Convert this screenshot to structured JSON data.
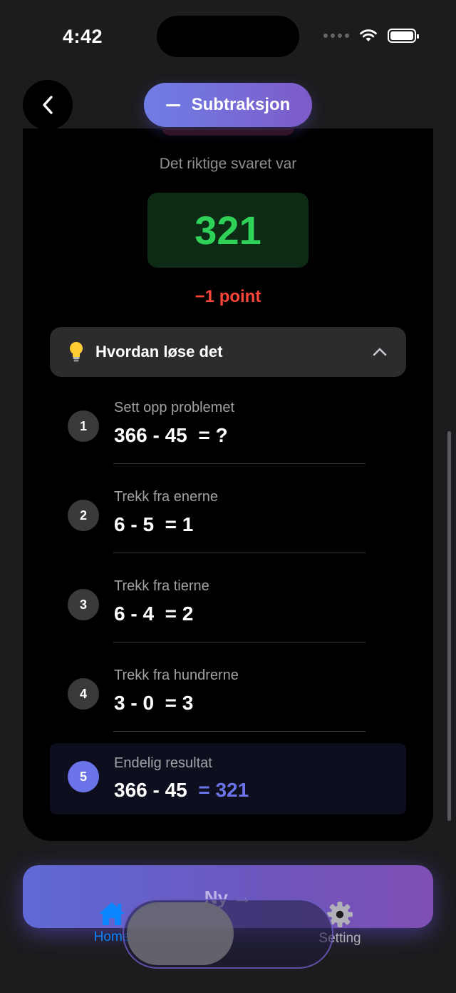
{
  "status_bar": {
    "time": "4:42"
  },
  "header": {
    "mode_label": "Subtraksjon"
  },
  "result": {
    "caption": "Det riktige svaret var",
    "correct_answer": "321",
    "penalty": "−1 point"
  },
  "howto": {
    "label": "Hvordan løse det"
  },
  "steps": [
    {
      "number": "1",
      "title": "Sett opp problemet",
      "expression": "366 - 45",
      "result": "= ?"
    },
    {
      "number": "2",
      "title": "Trekk fra enerne",
      "expression": "6 - 5",
      "result": "= 1"
    },
    {
      "number": "3",
      "title": "Trekk fra tierne",
      "expression": "6 - 4",
      "result": "= 2"
    },
    {
      "number": "4",
      "title": "Trekk fra hundrerne",
      "expression": "3 - 0",
      "result": "= 3"
    },
    {
      "number": "5",
      "title": "Endelig resultat",
      "expression": "366 - 45",
      "result": "= 321"
    }
  ],
  "next_button": {
    "label": "Ny →"
  },
  "tabs": [
    {
      "label": "Home",
      "icon": "house-icon",
      "active": true
    },
    {
      "label": "Setting",
      "icon": "gear-icon",
      "active": false
    }
  ],
  "colors": {
    "correct": "#30d158",
    "penalty": "#ff453a",
    "accent": "#6a74e8",
    "tab_active": "#0a84ff"
  }
}
